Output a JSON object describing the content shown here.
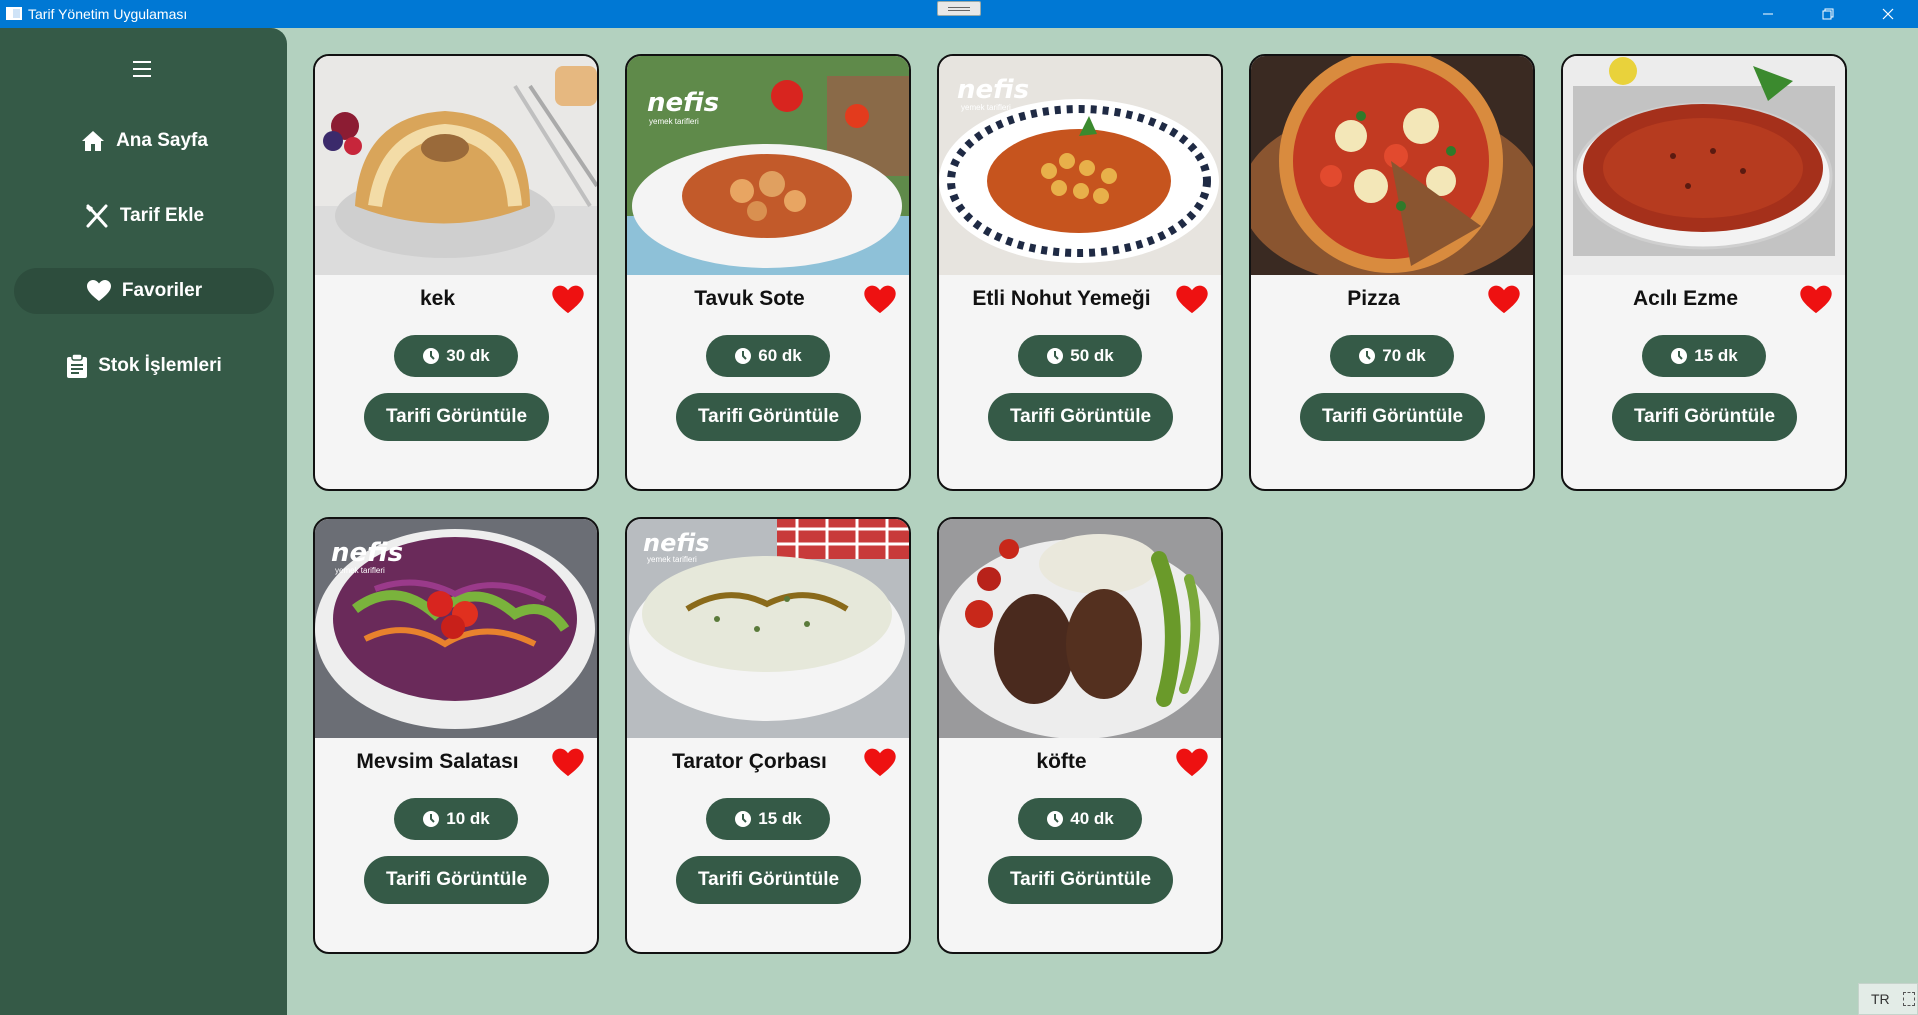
{
  "window": {
    "title": "Tarif Yönetim Uygulaması"
  },
  "sidebar": {
    "items": [
      {
        "label": "Ana Sayfa",
        "icon": "home-icon"
      },
      {
        "label": "Tarif Ekle",
        "icon": "utensils-icon"
      },
      {
        "label": "Favoriler",
        "icon": "heart-icon",
        "active": true
      },
      {
        "label": "Stok İşlemleri",
        "icon": "clipboard-icon"
      }
    ]
  },
  "recipes": [
    {
      "name": "kek",
      "time": "30 dk",
      "button": "Tarifi Görüntüle",
      "favorite": true
    },
    {
      "name": "Tavuk Sote",
      "time": "60 dk",
      "button": "Tarifi Görüntüle",
      "favorite": true,
      "watermark": "nefis",
      "watermark_sub": "yemek tarifleri"
    },
    {
      "name": "Etli Nohut Yemeği",
      "time": "50 dk",
      "button": "Tarifi Görüntüle",
      "favorite": true,
      "watermark": "nefis",
      "watermark_sub": "yemek tarifleri"
    },
    {
      "name": "Pizza",
      "time": "70 dk",
      "button": "Tarifi Görüntüle",
      "favorite": true
    },
    {
      "name": "Acılı Ezme",
      "time": "15 dk",
      "button": "Tarifi Görüntüle",
      "favorite": true
    },
    {
      "name": "Mevsim Salatası",
      "time": "10 dk",
      "button": "Tarifi Görüntüle",
      "favorite": true,
      "watermark": "nefis",
      "watermark_sub": "yemek tarifleri"
    },
    {
      "name": "Tarator Çorbası",
      "time": "15 dk",
      "button": "Tarifi Görüntüle",
      "favorite": true,
      "watermark": "nefis",
      "watermark_sub": "yemek tarifleri"
    },
    {
      "name": "köfte",
      "time": "40 dk",
      "button": "Tarifi Görüntüle",
      "favorite": true
    }
  ],
  "tray": {
    "lang": "TR"
  },
  "colors": {
    "sidebar": "#355a47",
    "background": "#b3d1bf",
    "heart": "#ee1111",
    "titlebar": "#0078d4"
  }
}
